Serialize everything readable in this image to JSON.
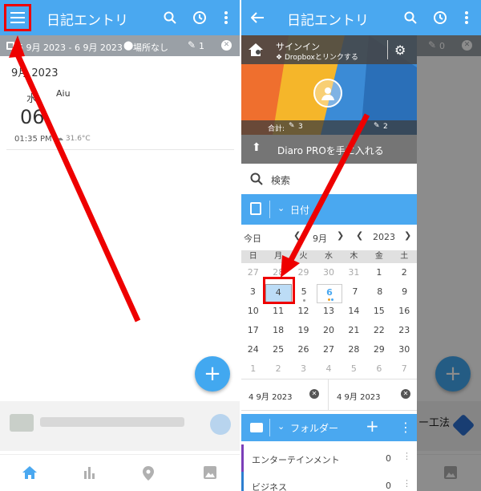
{
  "colors": {
    "accent": "#4aa8f0",
    "annotation": "#ee0000",
    "folder_entertainment": "#7b3fb8",
    "folder_business": "#2d7fd0"
  },
  "left": {
    "app_title": "日記エントリ",
    "filter": {
      "date_range": "6 9月 2023 - 6 9月 2023",
      "location": "場所なし",
      "count": "1"
    },
    "month_header": "9月 2023",
    "entry": {
      "weekday": "水",
      "day": "06",
      "time": "01:35 PM",
      "title": "Aiu",
      "temperature": "31.6°C"
    },
    "fab_label": "+"
  },
  "right": {
    "app_title": "日記エントリ",
    "filter_count": "0",
    "drawer": {
      "sign_in": "サインイン",
      "dropbox_link": "Dropboxとリンクする",
      "total_label": "合計:",
      "total_value": "3",
      "count_value": "2",
      "pro_label": "Diaro PROを手に入れる",
      "search_label": "検索",
      "date_label": "日付",
      "calendar": {
        "today_label": "今日",
        "month": "9月",
        "year": "2023",
        "weekdays": [
          "日",
          "月",
          "火",
          "水",
          "木",
          "金",
          "土"
        ],
        "weeks": [
          [
            "27",
            "28",
            "29",
            "30",
            "31",
            "1",
            "2"
          ],
          [
            "3",
            "4",
            "5",
            "6",
            "7",
            "8",
            "9"
          ],
          [
            "10",
            "11",
            "12",
            "13",
            "14",
            "15",
            "16"
          ],
          [
            "17",
            "18",
            "19",
            "20",
            "21",
            "22",
            "23"
          ],
          [
            "24",
            "25",
            "26",
            "27",
            "28",
            "29",
            "30"
          ],
          [
            "1",
            "2",
            "3",
            "4",
            "5",
            "6",
            "7"
          ]
        ]
      },
      "date_from": "4 9月 2023",
      "date_to": "4 9月 2023",
      "folder_label": "フォルダー",
      "folders": [
        {
          "name": "エンターテインメント",
          "count": "0"
        },
        {
          "name": "ビジネス",
          "count": "0"
        }
      ]
    },
    "behind_text": "ー工法"
  }
}
